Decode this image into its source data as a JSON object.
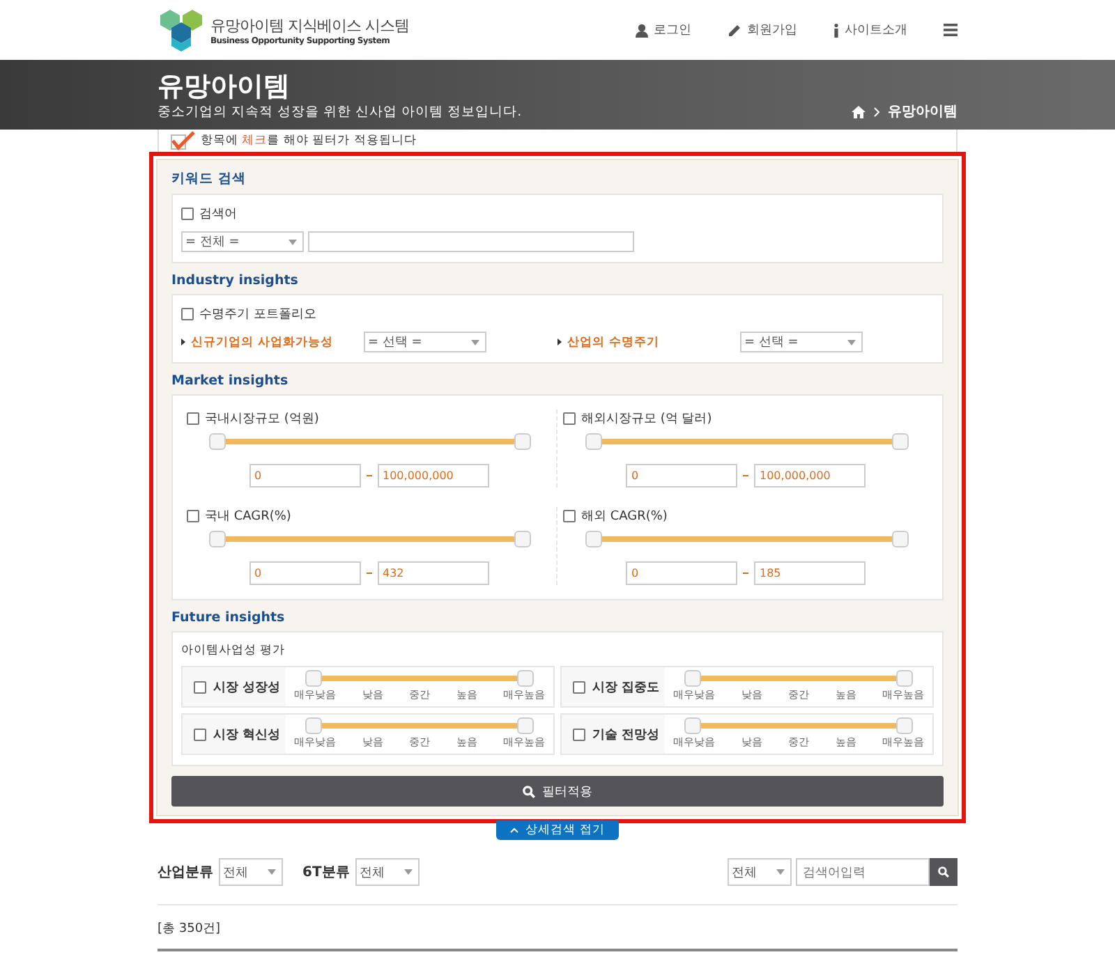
{
  "header": {
    "logo_title": "유망아이템 지식베이스 시스템",
    "logo_subtitle": "Business Opportunity Supporting System",
    "nav": [
      {
        "label": "로그인"
      },
      {
        "label": "회원가입"
      },
      {
        "label": "사이트소개"
      }
    ]
  },
  "banner": {
    "title": "유망아이템",
    "subtitle": "중소기업의 지속적 성장을 위한 신사업 아이템 정보입니다.",
    "breadcrumb": "유망아이템"
  },
  "notice": {
    "before": "항목에 ",
    "highlight": "체크",
    "after": "를 해야 필터가 적용됩니다"
  },
  "keyword": {
    "heading": "키워드 검색",
    "label": "검색어",
    "checked": false,
    "select": "= 전체 ="
  },
  "industry": {
    "heading": "Industry insights",
    "label": "수명주기 포트폴리오",
    "checked": false,
    "filters": [
      {
        "label": "신규기업의 사업화가능성",
        "select": "= 선택 ="
      },
      {
        "label": "산업의 수명주기",
        "select": "= 선택 ="
      }
    ]
  },
  "market": {
    "heading": "Market insights",
    "items": [
      {
        "label": "국내시장규모 (억원)",
        "checked": false,
        "thumbs": [
          {
            "level": 0
          },
          {
            "level": 1
          }
        ],
        "min": "0",
        "max": "100,000,000"
      },
      {
        "label": "해외시장규모 (억 달러)",
        "checked": false,
        "thumbs": [
          {
            "level": 0
          },
          {
            "level": 1
          }
        ],
        "min": "0",
        "max": "100,000,000"
      },
      {
        "label": "국내 CAGR(%)",
        "checked": false,
        "thumbs": [
          {
            "level": 0
          },
          {
            "level": 1
          }
        ],
        "min": "0",
        "max": "432"
      },
      {
        "label": "해외 CAGR(%)",
        "checked": false,
        "thumbs": [
          {
            "level": 0
          },
          {
            "level": 1
          }
        ],
        "min": "0",
        "max": "185"
      }
    ]
  },
  "future": {
    "heading": "Future insights",
    "subheading": "아이템사업성 평가",
    "items": [
      {
        "label": "시장 성장성",
        "checked": false,
        "thumbs": [
          {
            "level": 0
          },
          {
            "level": 1
          }
        ],
        "ticks": [
          "매우낮음",
          "낮음",
          "중간",
          "높음",
          "매우높음"
        ]
      },
      {
        "label": "시장 집중도",
        "checked": false,
        "thumbs": [
          {
            "level": 0
          },
          {
            "level": 1
          }
        ],
        "ticks": [
          "매우낮음",
          "낮음",
          "중간",
          "높음",
          "매우높음"
        ]
      },
      {
        "label": "시장 혁신성",
        "checked": false,
        "thumbs": [
          {
            "level": 0
          },
          {
            "level": 1
          }
        ],
        "ticks": [
          "매우낮음",
          "낮음",
          "중간",
          "높음",
          "매우높음"
        ]
      },
      {
        "label": "기술 전망성",
        "checked": false,
        "thumbs": [
          {
            "level": 0
          },
          {
            "level": 1
          }
        ],
        "ticks": [
          "매우낮음",
          "낮음",
          "중간",
          "높음",
          "매우높음"
        ]
      }
    ]
  },
  "apply_button": "필터적용",
  "collapse_button": "상세검색 접기",
  "filter_bar": {
    "industry_label": "산업분류",
    "industry_select": "전체",
    "sixt_label": "6T분류",
    "sixt_select": "전체",
    "scope_select": "전체",
    "search_placeholder": "검색어입력"
  },
  "total": "[총 350건]"
}
